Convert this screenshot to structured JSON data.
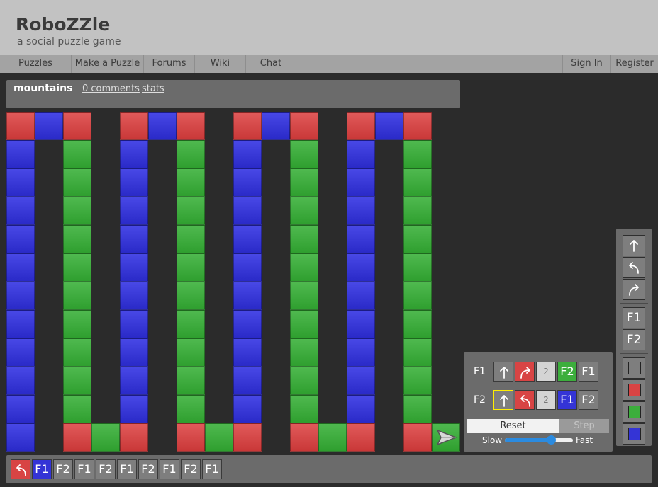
{
  "header": {
    "logo": "RoboZZle",
    "tagline": "a social puzzle game"
  },
  "nav": {
    "left": [
      "Puzzles",
      "Make a Puzzle",
      "Forums",
      "Wiki",
      "Chat"
    ],
    "right": [
      "Sign In",
      "Register"
    ]
  },
  "puzzle": {
    "title": "mountains",
    "comments_link": "0 comments",
    "stats_link": "stats"
  },
  "board": {
    "columns": 16,
    "rows": 12,
    "grid": [
      "RBR.RBR.RBR.RBR.",
      "B.G.B.G.B.G.B.G.",
      "B.G.B.G.B.G.B.G.",
      "B.G.B.G.B.G.B.G.",
      "B.G.B.G.B.G.B.G.",
      "B.G.B.G.B.G.B.G.",
      "B.G.B.G.B.G.B.G.",
      "B.G.B.G.B.G.B.G.",
      "B.G.B.G.B.G.B.G.",
      "B.G.B.G.B.G.B.G.",
      "B.G.B.G.B.G.B.G.",
      "B.RGR.RGR.RGR.RG"
    ],
    "robot": {
      "row": 11,
      "col": 15,
      "direction": "right"
    }
  },
  "program": {
    "functions": [
      {
        "label": "F1",
        "slots": [
          {
            "color": "gray",
            "op": "forward"
          },
          {
            "color": "red",
            "op": "turn-right"
          },
          {
            "color": "empty",
            "op": "2"
          },
          {
            "color": "green",
            "op": "F2"
          },
          {
            "color": "gray",
            "op": "F1"
          }
        ]
      },
      {
        "label": "F2",
        "slots": [
          {
            "color": "gray",
            "op": "forward",
            "selected": true
          },
          {
            "color": "red",
            "op": "turn-left"
          },
          {
            "color": "empty",
            "op": "2"
          },
          {
            "color": "blue",
            "op": "F1"
          },
          {
            "color": "gray",
            "op": "F2"
          }
        ]
      }
    ],
    "reset_label": "Reset",
    "step_label": "Step",
    "slow_label": "Slow",
    "fast_label": "Fast",
    "speed_fraction": 0.68
  },
  "palette": {
    "commands": [
      "forward",
      "turn-left",
      "turn-right"
    ],
    "functions": [
      "F1",
      "F2"
    ],
    "colors": [
      "gray",
      "red",
      "green",
      "blue"
    ]
  },
  "stack": [
    {
      "color": "red",
      "op": "turn-left"
    },
    {
      "color": "blue",
      "op": "F1"
    },
    {
      "color": "gray",
      "op": "F2"
    },
    {
      "color": "gray",
      "op": "F1"
    },
    {
      "color": "gray",
      "op": "F2"
    },
    {
      "color": "gray",
      "op": "F1"
    },
    {
      "color": "gray",
      "op": "F2"
    },
    {
      "color": "gray",
      "op": "F1"
    },
    {
      "color": "gray",
      "op": "F2"
    },
    {
      "color": "gray",
      "op": "F1"
    }
  ],
  "colors": {
    "red": "#d84444",
    "green": "#3cae3c",
    "blue": "#3434d6",
    "gray": "#7e7e7e",
    "empty": "#d4d4d4",
    "background": "#2b2b2b",
    "panel": "#6b6b6b",
    "header": "#c2c2c2",
    "nav": "#a3a3a3"
  }
}
